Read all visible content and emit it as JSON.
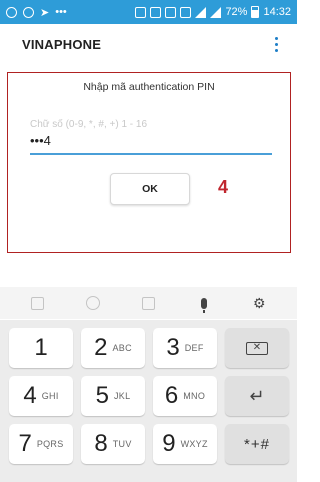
{
  "status_bar": {
    "battery": "72%",
    "time": "14:32",
    "icons": [
      "sync-icon",
      "circle-icon",
      "telegram-icon",
      "dots-icon",
      "alarm-icon",
      "mute-icon",
      "nfc-icon",
      "data-icon",
      "wifi-icon",
      "signal-icon",
      "battery-icon"
    ]
  },
  "app_bar": {
    "title": "VINAPHONE",
    "menu_icon": "more-vert-icon"
  },
  "dialog": {
    "title": "Nhập mã authentication PIN",
    "pin_hint": "Chữ số (0-9, *, #, +) 1 - 16",
    "pin_value": "•••4",
    "ok_label": "OK",
    "step_number": "4",
    "border_color": "#b02222",
    "accent_color": "#4a9fd8"
  },
  "keyboard_toolbar": {
    "icons": [
      "sticker-icon",
      "emoji-icon",
      "gif-icon",
      "mic-icon",
      "settings-icon"
    ]
  },
  "keypad": {
    "k1": {
      "digit": "1",
      "letters": ""
    },
    "k2": {
      "digit": "2",
      "letters": "ABC"
    },
    "k3": {
      "digit": "3",
      "letters": "DEF"
    },
    "k4": {
      "digit": "4",
      "letters": "GHI"
    },
    "k5": {
      "digit": "5",
      "letters": "JKL"
    },
    "k6": {
      "digit": "6",
      "letters": "MNO"
    },
    "k7": {
      "digit": "7",
      "letters": "PQRS"
    },
    "k8": {
      "digit": "8",
      "letters": "TUV"
    },
    "k9": {
      "digit": "9",
      "letters": "WXYZ"
    },
    "symbols": "*+#",
    "backspace_icon": "backspace-icon",
    "enter_icon": "enter-icon"
  }
}
